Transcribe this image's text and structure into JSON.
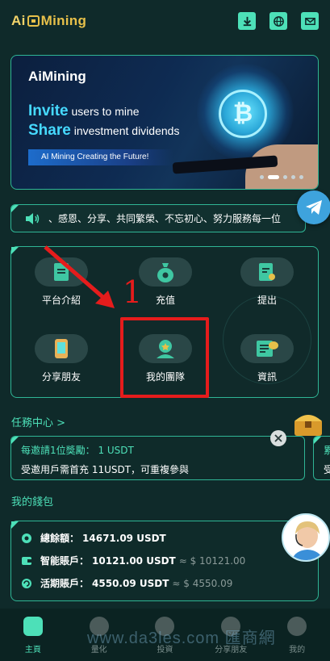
{
  "header": {
    "logo_text": "AiMining",
    "icons": [
      "download-icon",
      "globe-icon",
      "mail-icon"
    ]
  },
  "banner": {
    "logo_text": "AiMining",
    "invite_word": "Invite",
    "invite_rest": " users to mine",
    "share_word": "Share",
    "share_rest": " investment dividends",
    "tagline": "AI Mining Creating the Future!",
    "coin_glyph": "₿",
    "slides_total": 5,
    "slide_active": 1
  },
  "notice": {
    "text": "、感恩、分享、共同繁榮、不忘初心、努力服務每一位"
  },
  "grid": {
    "items": [
      {
        "label": "平台介紹",
        "icon": "document-icon"
      },
      {
        "label": "充值",
        "icon": "money-bag-icon"
      },
      {
        "label": "提出",
        "icon": "withdraw-doc-icon"
      },
      {
        "label": "分享朋友",
        "icon": "phone-share-icon"
      },
      {
        "label": "我的團隊",
        "icon": "team-icon"
      },
      {
        "label": "資訊",
        "icon": "news-icon"
      }
    ]
  },
  "annotation": {
    "number": "1",
    "color": "#e51c1c"
  },
  "tasks": {
    "title": "任務中心 >",
    "card1": {
      "reward_line": "每邀請1位獎勵： 1 USDT",
      "condition": "受邀用戶需首充 11USDT，可重複參與"
    },
    "card2": {
      "reward_line": "累",
      "condition": "受"
    }
  },
  "wallet": {
    "title": "我的錢包",
    "total_label": "總餘額：",
    "total_value": "14671.09 USDT",
    "smart_label": "智能賬戶：",
    "smart_value": "10121.00 USDT",
    "smart_approx": "≈ $ 10121.00",
    "flex_label": "活期賬戶：",
    "flex_value": "4550.09 USDT",
    "flex_approx": "≈ $ 4550.09"
  },
  "nav": {
    "items": [
      {
        "label": "主頁",
        "active": true
      },
      {
        "label": "量化",
        "active": false
      },
      {
        "label": "投資",
        "active": false
      },
      {
        "label": "分享朋友",
        "active": false
      },
      {
        "label": "我的",
        "active": false
      }
    ]
  },
  "watermark": "www.da3les.com 匯商網",
  "colors": {
    "accent": "#4de0b8",
    "background": "#0f2a2a",
    "annotation": "#e51c1c"
  }
}
